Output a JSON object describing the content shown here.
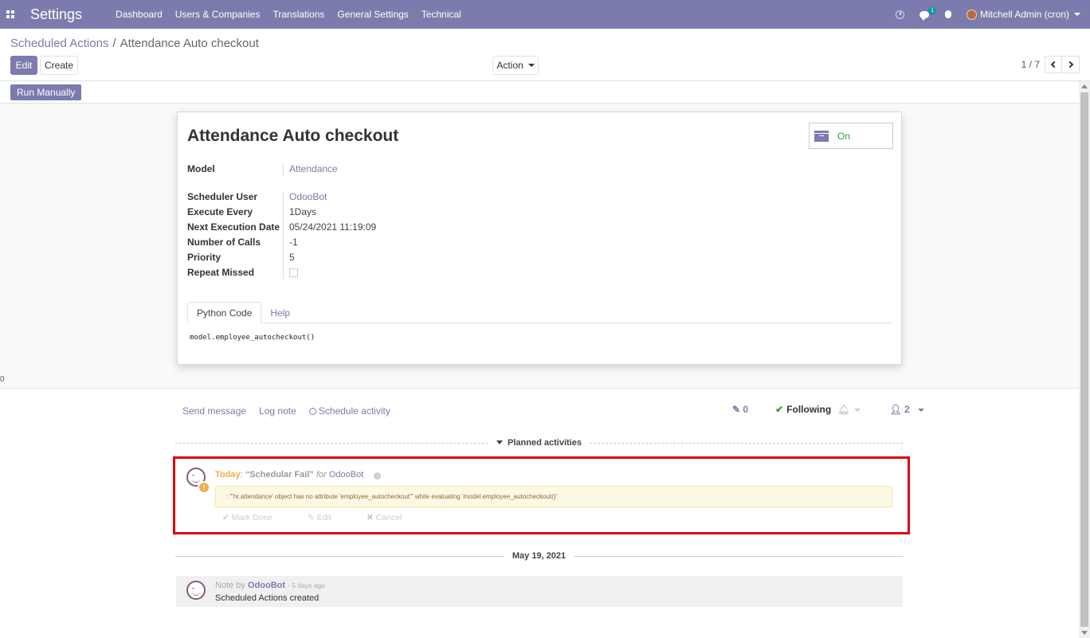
{
  "navbar": {
    "brand": "Settings",
    "menu": [
      "Dashboard",
      "Users & Companies",
      "Translations",
      "General Settings",
      "Technical"
    ],
    "chat_badge": "1",
    "user": "Mitchell Admin (cron)"
  },
  "control_panel": {
    "breadcrumb_parent": "Scheduled Actions",
    "breadcrumb_sep": "/",
    "breadcrumb_current": "Attendance Auto checkout",
    "edit_label": "Edit",
    "create_label": "Create",
    "action_label": "Action",
    "pager_value": "1 / 7"
  },
  "statusbar": {
    "run_manually_label": "Run Manually"
  },
  "form": {
    "title": "Attendance Auto checkout",
    "active_label": "On",
    "fields": {
      "model_label": "Model",
      "model_value": "Attendance",
      "user_label": "Scheduler User",
      "user_value": "OdooBot",
      "interval_label": "Execute Every",
      "interval_value": "1Days",
      "nextcall_label": "Next Execution Date",
      "nextcall_value": "05/24/2021 11:19:09",
      "numcall_label": "Number of Calls",
      "numcall_value": "-1",
      "priority_label": "Priority",
      "priority_value": "5",
      "doall_label": "Repeat Missed"
    },
    "tabs": [
      "Python Code",
      "Help"
    ],
    "code": "model.employee_autocheckout()",
    "stray_text": "0"
  },
  "chatter": {
    "send_message": "Send message",
    "log_note": "Log note",
    "schedule_activity": "Schedule activity",
    "attachments_count": "0",
    "following_label": "Following",
    "followers_count": "2",
    "planned_label": "Planned activities",
    "activity": {
      "when": "Today",
      "colon": ":",
      "summary": "“Schedular Fail”",
      "for_label": "for",
      "user": "OdooBot",
      "note": ": '\"hr.attendance' object has no attribute 'employee_autocheckout'\" while evaluating 'model.employee_autocheckout()'",
      "mark_done": "Mark Done",
      "edit": "Edit",
      "cancel": "Cancel"
    },
    "date_separator": "May 19, 2021",
    "message": {
      "prefix": "Note by",
      "author": "OdooBot",
      "age": "- 5 days ago",
      "body": "Scheduled Actions created"
    }
  },
  "colors": {
    "brand": "#7c7bad",
    "active_green": "#28a745",
    "warning": "#f0ad4e",
    "highlight_red": "#e0000f"
  }
}
